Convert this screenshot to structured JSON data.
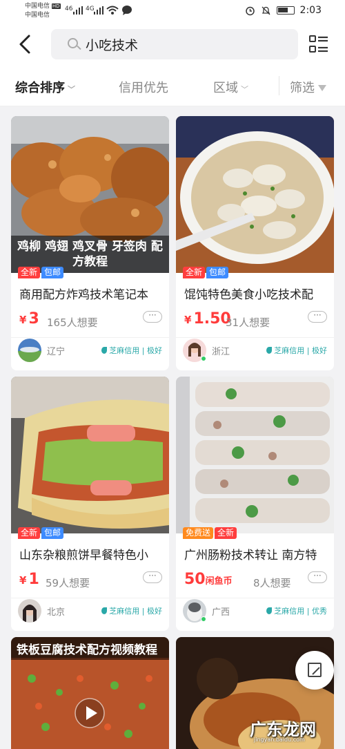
{
  "status_bar": {
    "carrier1": "中国电信",
    "carrier1_badge": "HD",
    "carrier2": "中国电信",
    "net1": "46",
    "net2": "4G",
    "time": "2:03"
  },
  "search": {
    "query": "小吃技术"
  },
  "sort": {
    "comprehensive": "综合排序",
    "credit_first": "信用优先",
    "region": "区域",
    "filter": "筛选"
  },
  "items": [
    {
      "caption": "鸡柳 鸡翅 鸡叉骨 牙签肉 配方教程",
      "tags": [
        "全新",
        "包邮"
      ],
      "title": "商用配方炸鸡技术笔记本",
      "price_symbol": "¥",
      "price": "3",
      "want": "165人想要",
      "more": "···",
      "location": "辽宁",
      "credit": "芝麻信用 | 极好"
    },
    {
      "tags": [
        "全新",
        "包邮"
      ],
      "title": "馄饨特色美食小吃技术配",
      "price_symbol": "¥",
      "price": "1.50",
      "want": "31人想要",
      "more": "···",
      "location": "浙江",
      "credit": "芝麻信用 | 极好"
    },
    {
      "tags": [
        "全新",
        "包邮"
      ],
      "title": "山东杂粮煎饼早餐特色小",
      "price_symbol": "¥",
      "price": "1",
      "want": "59人想要",
      "more": "···",
      "location": "北京",
      "credit": "芝麻信用 | 极好"
    },
    {
      "tags": [
        "免费送",
        "全新"
      ],
      "title": "广州肠粉技术转让 南方特",
      "price": "50",
      "price_unit": "闲鱼币",
      "want": "8人想要",
      "more": "···",
      "location": "广西",
      "credit": "芝麻信用 | 优秀"
    },
    {
      "caption": "铁板豆腐技术配方视频教程"
    },
    {}
  ],
  "watermark": {
    "text": "广东龙网",
    "url": "jingyan.baidu.com"
  },
  "icons": {
    "back": "back-arrow-icon",
    "search": "search-icon",
    "layout": "list-layout-icon",
    "filter": "filter-funnel-icon",
    "more": "more-dots-icon",
    "fab": "edit-icon",
    "play": "play-icon"
  },
  "colors": {
    "price": "#ff3b3b",
    "tag_new": "#ff3e3e",
    "tag_free_shipping": "#3d8bff",
    "tag_free": "#ff8a1e",
    "credit": "#2aa8a8"
  }
}
